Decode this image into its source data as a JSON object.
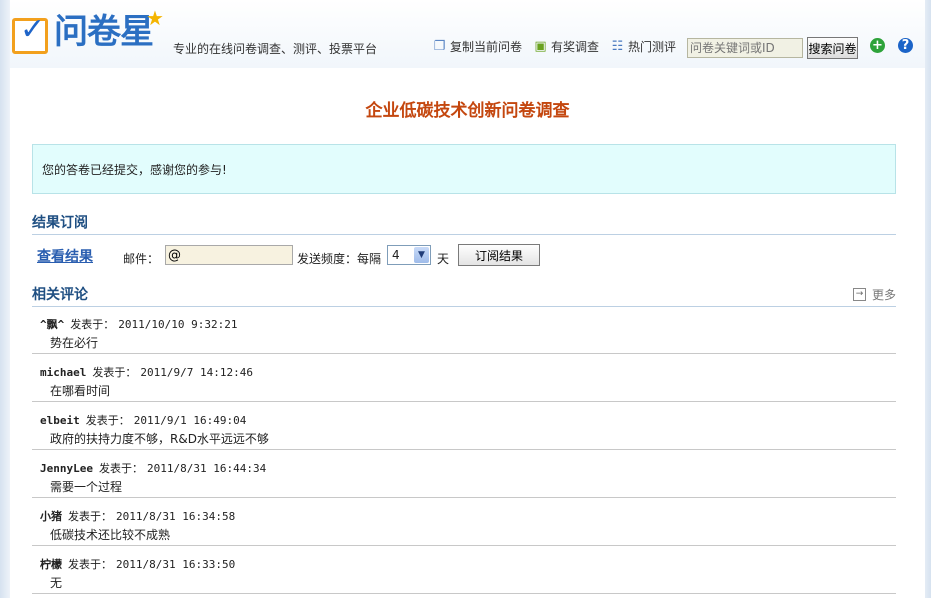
{
  "header": {
    "logo_text": "问卷星",
    "slogan": "专业的在线问卷调查、测评、投票平台",
    "links": [
      {
        "label": "复制当前问卷",
        "icon": "copy-icon"
      },
      {
        "label": "有奖调查",
        "icon": "gift-icon"
      },
      {
        "label": "热门测评",
        "icon": "list-icon"
      }
    ],
    "search_placeholder": "问卷关键词或ID",
    "search_button": "搜索问卷"
  },
  "main": {
    "title": "企业低碳技术创新问卷调查",
    "notice": "您的答卷已经提交，感谢您的参与!",
    "subscribe": {
      "heading": "结果订阅",
      "view_results": "查看结果",
      "email_label": "邮件：",
      "email_value": "@",
      "freq_label": "发送频度：每隔",
      "freq_value": "4",
      "day_label": "天",
      "button": "订阅结果"
    },
    "comments_section": {
      "heading": "相关评论",
      "more": "更多",
      "posted_label": "发表于：",
      "items": [
        {
          "user": "^飘^",
          "time": "2011/10/10 9:32:21",
          "text": "势在必行"
        },
        {
          "user": "michael",
          "time": "2011/9/7 14:12:46",
          "text": "在哪看时间"
        },
        {
          "user": "elbeit",
          "time": "2011/9/1 16:49:04",
          "text": "政府的扶持力度不够，R&D水平远远不够"
        },
        {
          "user": "JennyLee",
          "time": "2011/8/31 16:44:34",
          "text": "需要一个过程"
        },
        {
          "user": "小猪",
          "time": "2011/8/31 16:34:58",
          "text": "低碳技术还比较不成熟"
        },
        {
          "user": "柠檬",
          "time": "2011/8/31 16:33:50",
          "text": "无"
        }
      ]
    }
  }
}
